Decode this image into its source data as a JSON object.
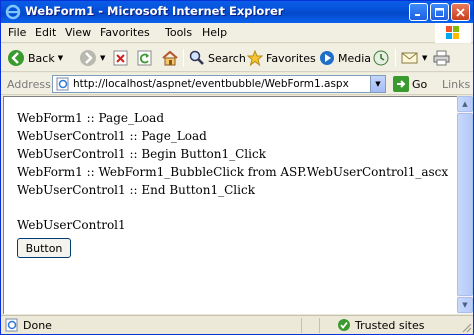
{
  "window": {
    "title": "WebForm1 - Microsoft Internet Explorer"
  },
  "menu": {
    "items": [
      "File",
      "Edit",
      "View",
      "Favorites",
      "Tools",
      "Help"
    ]
  },
  "toolbar": {
    "back_label": "Back",
    "search_label": "Search",
    "favorites_label": "Favorites",
    "media_label": "Media"
  },
  "address": {
    "label": "Address",
    "url": "http://localhost/aspnet/eventbubble/WebForm1.aspx",
    "go_label": "Go",
    "links_label": "Links"
  },
  "content": {
    "lines": [
      "WebForm1 :: Page_Load",
      "WebUserControl1 :: Page_Load",
      "WebUserControl1 :: Begin Button1_Click",
      "WebForm1 :: WebForm1_BubbleClick from ASP.WebUserControl1_ascx",
      "WebUserControl1 :: End Button1_Click"
    ],
    "control_label": "WebUserControl1",
    "button_label": "Button"
  },
  "status": {
    "text": "Done",
    "zone": "Trusted sites"
  },
  "colors": {
    "titlebar": "#0450d6",
    "accent": "#0831d9",
    "go_green": "#3a9a2e"
  }
}
